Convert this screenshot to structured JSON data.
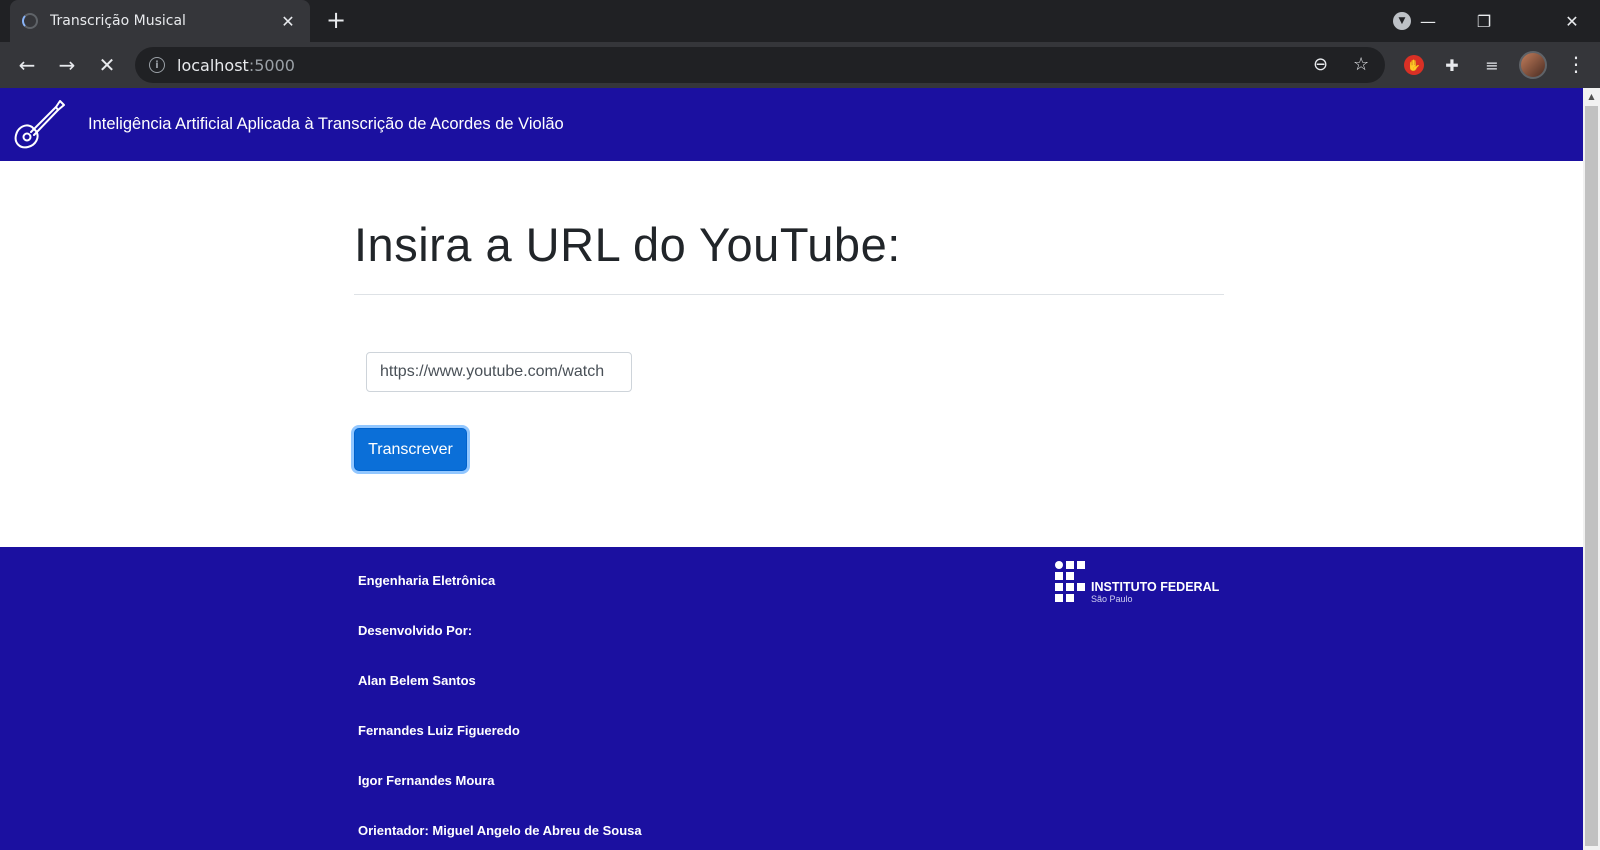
{
  "browser": {
    "tab_title": "Transcrição Musical",
    "url_host": "localhost",
    "url_port": ":5000"
  },
  "header": {
    "title": "Inteligência Artificial Aplicada à Transcrição de Acordes de Violão"
  },
  "main": {
    "heading": "Insira a URL do YouTube:",
    "url_input_value": "https://www.youtube.com/watch",
    "submit_label": "Transcrever"
  },
  "footer": {
    "lines": [
      "Engenharia Eletrônica",
      "Desenvolvido Por:",
      "Alan Belem Santos",
      "Fernandes Luiz Figueredo",
      "Igor Fernandes Moura",
      "Orientador: Miguel Angelo de Abreu de Sousa"
    ],
    "logo_name": "INSTITUTO FEDERAL",
    "logo_campus": "São Paulo"
  },
  "colors": {
    "brand_blue": "#1b10a0",
    "button_blue": "#0b6fd8"
  },
  "icons": [
    "guitar-icon",
    "instituto-federal-logo",
    "info-icon",
    "star-icon",
    "zoom-out-icon",
    "extensions-icon",
    "media-control-icon",
    "adblock-icon"
  ]
}
